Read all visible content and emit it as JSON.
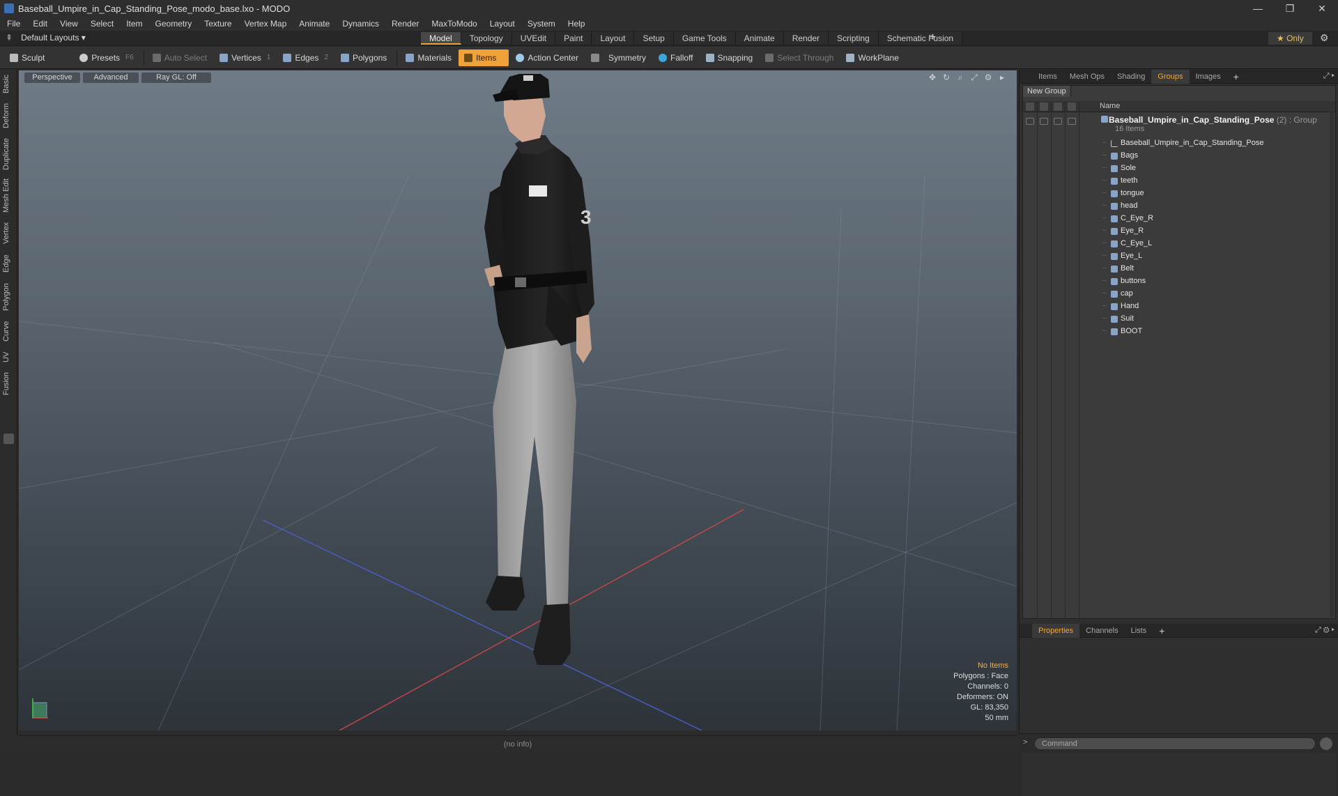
{
  "window": {
    "title": "Baseball_Umpire_in_Cap_Standing_Pose_modo_base.lxo - MODO",
    "min": "—",
    "restore": "❐",
    "close": "✕"
  },
  "menubar": [
    "File",
    "Edit",
    "View",
    "Select",
    "Item",
    "Geometry",
    "Texture",
    "Vertex Map",
    "Animate",
    "Dynamics",
    "Render",
    "MaxToModo",
    "Layout",
    "System",
    "Help"
  ],
  "layoutbar": {
    "layout_dropdown": "Default Layouts ▾",
    "tabs": [
      "Model",
      "Topology",
      "UVEdit",
      "Paint",
      "Layout",
      "Setup",
      "Game Tools",
      "Animate",
      "Render",
      "Scripting",
      "Schematic Fusion"
    ],
    "active_tab": "Model",
    "plus": "+",
    "only": "★ Only"
  },
  "toolbar": {
    "sculpt": "Sculpt",
    "presets": "Presets",
    "presets_key": "F6",
    "auto_select": "Auto Select",
    "vertices": "Vertices",
    "vertices_num": "1",
    "edges": "Edges",
    "edges_num": "2",
    "polygons": "Polygons",
    "materials": "Materials",
    "items": "Items",
    "action_center": "Action Center",
    "symmetry": "Symmetry",
    "falloff": "Falloff",
    "snapping": "Snapping",
    "select_through": "Select Through",
    "workplane": "WorkPlane"
  },
  "lefttabs": [
    "Basic",
    "Deform",
    "Duplicate",
    "Mesh Edit",
    "Vertex",
    "Edge",
    "Polygon",
    "Curve",
    "UV",
    "Fusion"
  ],
  "viewport": {
    "view": "Perspective",
    "advanced": "Advanced",
    "raygl": "Ray GL: Off",
    "info": {
      "items": "No Items",
      "polygons": "Polygons : Face",
      "channels": "Channels: 0",
      "deformers": "Deformers: ON",
      "gl": "GL: 83,350",
      "focal": "50 mm"
    }
  },
  "status": "(no info)",
  "rightpanel": {
    "top_tabs": [
      "Items",
      "Mesh Ops",
      "Shading",
      "Groups",
      "Images"
    ],
    "top_active": "Groups",
    "new_group": "New Group",
    "name_header": "Name",
    "group": {
      "name": "Baseball_Umpire_in_Cap_Standing_Pose",
      "count": "(2) : Group",
      "sub": "16 Items"
    },
    "items": [
      "Baseball_Umpire_in_Cap_Standing_Pose",
      "Bags",
      "Sole",
      "teeth",
      "tongue",
      "head",
      "C_Eye_R",
      "Eye_R",
      "C_Eye_L",
      "Eye_L",
      "Belt",
      "buttons",
      "cap",
      "Hand",
      "Suit",
      "BOOT"
    ],
    "bottom_tabs": [
      "Properties",
      "Channels",
      "Lists"
    ],
    "bottom_active": "Properties",
    "command_placeholder": "Command"
  },
  "colors": {
    "accent": "#f1a239",
    "background": "#2b2b2b"
  }
}
